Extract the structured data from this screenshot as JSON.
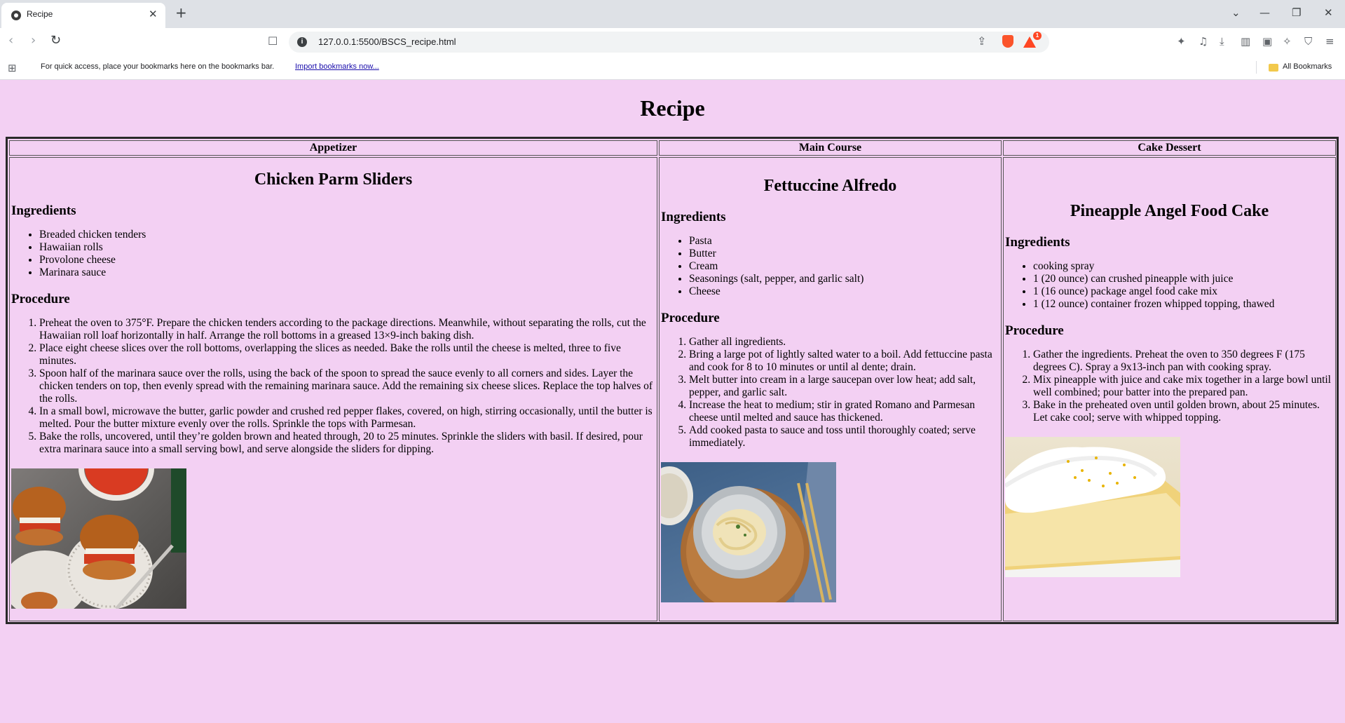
{
  "browser": {
    "tab_title": "Recipe",
    "url": "127.0.0.1:5500/BSCS_recipe.html",
    "rewards_count": "1",
    "bookmarks_hint": "For quick access, place your bookmarks here on the bookmarks bar.",
    "import_link": "Import bookmarks now...",
    "all_bookmarks": "All Bookmarks"
  },
  "page": {
    "title": "Recipe",
    "columns": [
      {
        "header": "Appetizer",
        "dish": "Chicken Parm Sliders",
        "ingredients_heading": "Ingredients",
        "ingredients": [
          "Breaded chicken tenders",
          "Hawaiian rolls",
          "Provolone cheese",
          "Marinara sauce"
        ],
        "procedure_heading": "Procedure",
        "procedure": [
          "Preheat the oven to 375°F. Prepare the chicken tenders according to the package directions. Meanwhile, without separating the rolls, cut the Hawaiian roll loaf horizontally in half. Arrange the roll bottoms in a greased 13×9-inch baking dish.",
          "Place eight cheese slices over the roll bottoms, overlapping the slices as needed. Bake the rolls until the cheese is melted, three to five minutes.",
          "Spoon half of the marinara sauce over the rolls, using the back of the spoon to spread the sauce evenly to all corners and sides. Layer the chicken tenders on top, then evenly spread with the remaining marinara sauce. Add the remaining six cheese slices. Replace the top halves of the rolls.",
          "In a small bowl, microwave the butter, garlic powder and crushed red pepper flakes, covered, on high, stirring occasionally, until the butter is melted. Pour the butter mixture evenly over the rolls. Sprinkle the tops with Parmesan.",
          "Bake the rolls, uncovered, until they’re golden brown and heated through, 20 to 25 minutes. Sprinkle the sliders with basil. If desired, pour extra marinara sauce into a small serving bowl, and serve alongside the sliders for dipping."
        ]
      },
      {
        "header": "Main Course",
        "dish": "Fettuccine Alfredo",
        "ingredients_heading": "Ingredients",
        "ingredients": [
          "Pasta",
          "Butter",
          "Cream",
          "Seasonings (salt, pepper, and garlic salt)",
          "Cheese"
        ],
        "procedure_heading": "Procedure",
        "procedure": [
          "Gather all ingredients.",
          "Bring a large pot of lightly salted water to a boil. Add fettuccine pasta and cook for 8 to 10 minutes or until al dente; drain.",
          "Melt butter into cream in a large saucepan over low heat; add salt, pepper, and garlic salt.",
          "Increase the heat to medium; stir in grated Romano and Parmesan cheese until melted and sauce has thickened.",
          "Add cooked pasta to sauce and toss until thoroughly coated; serve immediately."
        ]
      },
      {
        "header": "Cake Dessert",
        "dish": "Pineapple Angel Food Cake",
        "ingredients_heading": "Ingredients",
        "ingredients": [
          "cooking spray",
          "1 (20 ounce) can crushed pineapple with juice",
          "1 (16 ounce) package angel food cake mix",
          "1 (12 ounce) container frozen whipped topping, thawed"
        ],
        "procedure_heading": "Procedure",
        "procedure": [
          "Gather the ingredients. Preheat the oven to 350 degrees F (175 degrees C). Spray a 9x13-inch pan with cooking spray.",
          "Mix pineapple with juice and cake mix together in a large bowl until well combined; pour batter into the prepared pan.",
          "Bake in the preheated oven until golden brown, about 25 minutes. Let cake cool; serve with whipped topping."
        ]
      }
    ]
  },
  "colors": {
    "page_background": "#f3d0f3",
    "table_border": "#2a2a2a"
  }
}
